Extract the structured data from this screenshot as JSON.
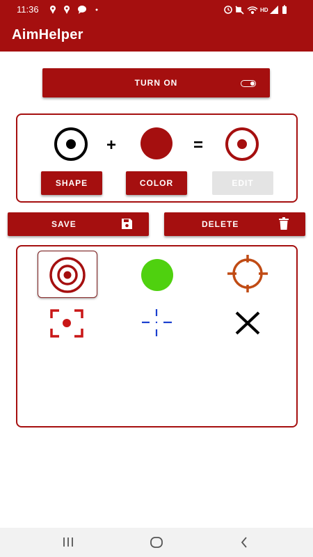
{
  "status_bar": {
    "time": "11:36",
    "left_icons": [
      "location-icon",
      "location-icon",
      "message-icon",
      "dot-icon"
    ],
    "right_icons": [
      "alarm-icon",
      "mute-icon",
      "wifi-icon",
      "hd-icon",
      "signal-icon",
      "battery-icon"
    ],
    "hd_label": "HD"
  },
  "app_bar": {
    "title": "AimHelper"
  },
  "turn_on_button": {
    "label": "TURN ON",
    "icon": "toggle-icon"
  },
  "builder": {
    "plus_symbol": "+",
    "equals_symbol": "=",
    "shape_label": "SHAPE",
    "color_label": "COLOR",
    "edit_label": "EDIT",
    "edit_enabled": false,
    "selected_shape": "ring-dot-crosshair",
    "selected_color": "#a50f0f"
  },
  "actions": {
    "save_label": "SAVE",
    "save_icon": "floppy-disk-icon",
    "delete_label": "DELETE",
    "delete_icon": "trash-icon"
  },
  "saved_crosshairs": [
    {
      "name": "red ring with dot",
      "color": "#a50f0f",
      "selected": true
    },
    {
      "name": "green dot",
      "color": "#4fd10f",
      "selected": false
    },
    {
      "name": "orange scope",
      "color": "#c04b14",
      "selected": false
    },
    {
      "name": "red corner brackets",
      "color": "#c91717",
      "selected": false
    },
    {
      "name": "blue dashed cross",
      "color": "#1a3fcf",
      "selected": false
    },
    {
      "name": "black x",
      "color": "#000000",
      "selected": false
    }
  ],
  "nav_bar": {
    "buttons": [
      "recent-apps-icon",
      "home-icon",
      "back-icon"
    ]
  },
  "colors": {
    "accent": "#a50f0f",
    "disabled": "#e4e4e4"
  }
}
